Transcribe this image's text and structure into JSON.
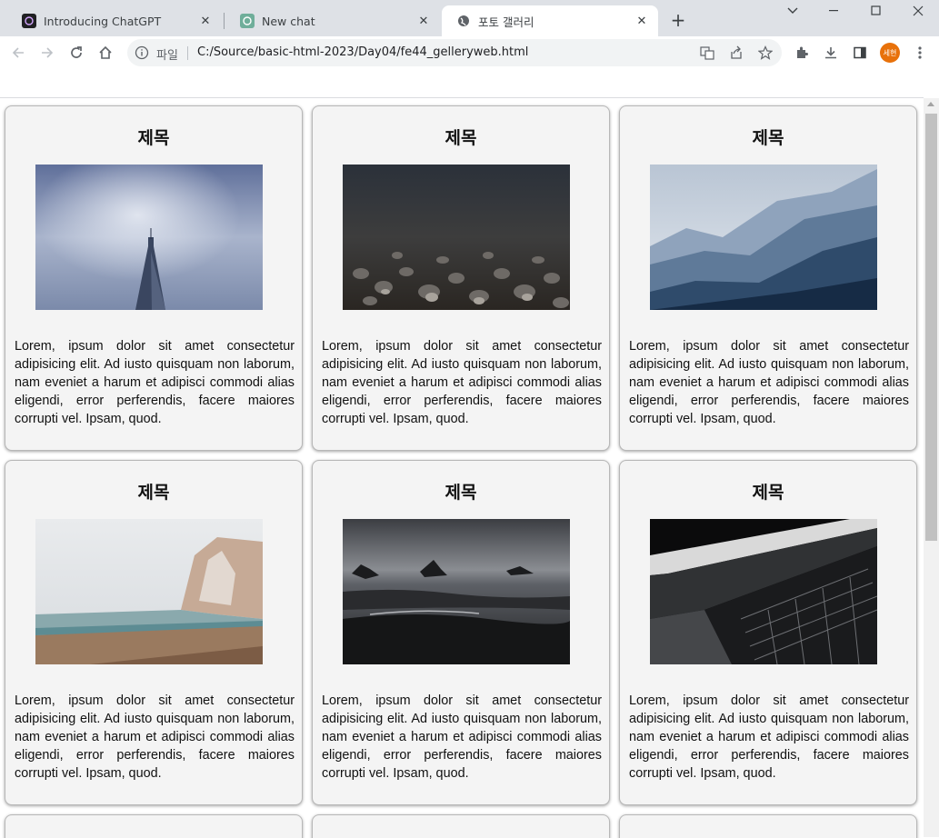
{
  "browser": {
    "tabs": [
      {
        "label": "Introducing ChatGPT",
        "icon": "chatgpt-dark-icon",
        "active": false
      },
      {
        "label": "New chat",
        "icon": "chatgpt-green-icon",
        "active": false
      },
      {
        "label": "포토 갤러리",
        "icon": "globe-icon",
        "active": true
      }
    ],
    "address": {
      "scheme_label": "파일",
      "url": "C:/Source/basic-html-2023/Day04/fe44_gelleryweb.html"
    },
    "profile_label": "세현"
  },
  "gallery": {
    "cards": [
      {
        "title": "제목",
        "photo": "skyscraper-in-fog",
        "text": "Lorem, ipsum dolor sit amet consectetur adipisicing elit. Ad iusto quisquam non laborum, nam eveniet a harum et adipisci commodi alias eligendi, error perferendis, facere maiores corrupti vel. Ipsam, quod."
      },
      {
        "title": "제목",
        "photo": "pebbles-underwater",
        "text": "Lorem, ipsum dolor sit amet consectetur adipisicing elit. Ad iusto quisquam non laborum, nam eveniet a harum et adipisci commodi alias eligendi, error perferendis, facere maiores corrupti vel. Ipsam, quod."
      },
      {
        "title": "제목",
        "photo": "misty-mountains",
        "text": "Lorem, ipsum dolor sit amet consectetur adipisicing elit. Ad iusto quisquam non laborum, nam eveniet a harum et adipisci commodi alias eligendi, error perferendis, facere maiores corrupti vel. Ipsam, quod."
      },
      {
        "title": "제목",
        "photo": "chalk-cliffs-beach",
        "text": "Lorem, ipsum dolor sit amet consectetur adipisicing elit. Ad iusto quisquam non laborum, nam eveniet a harum et adipisci commodi alias eligendi, error perferendis, facere maiores corrupti vel. Ipsam, quod."
      },
      {
        "title": "제목",
        "photo": "rocky-shore-dark",
        "text": "Lorem, ipsum dolor sit amet consectetur adipisicing elit. Ad iusto quisquam non laborum, nam eveniet a harum et adipisci commodi alias eligendi, error perferendis, facere maiores corrupti vel. Ipsam, quod."
      },
      {
        "title": "제목",
        "photo": "dark-architecture",
        "text": "Lorem, ipsum dolor sit amet consectetur adipisicing elit. Ad iusto quisquam non laborum, nam eveniet a harum et adipisci commodi alias eligendi, error perferendis, facere maiores corrupti vel. Ipsam, quod."
      }
    ]
  },
  "colors": {
    "tabstrip_bg": "#dee1e6",
    "card_bg": "#f4f4f4",
    "avatar_bg": "#e8710a"
  }
}
